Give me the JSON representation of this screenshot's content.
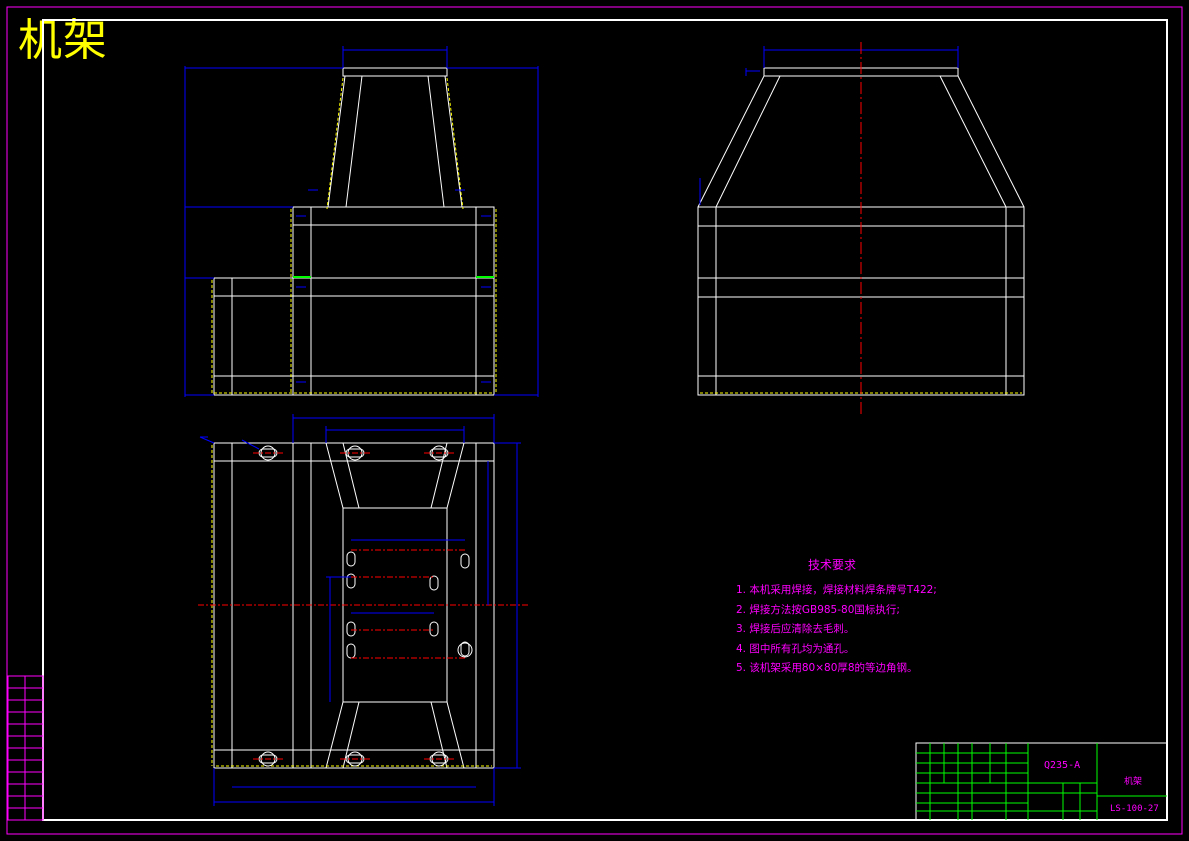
{
  "drawing": {
    "title": "机架",
    "line_colors": {
      "outline": "#ffffff",
      "dimension": "#0000ff",
      "center": "#ff0000",
      "frame": "#ff00ff",
      "weld": "#ffff00",
      "table": "#00ff00"
    }
  },
  "technical_requirements": {
    "heading": "技术要求",
    "items": [
      "1. 本机采用焊接，焊接材料焊条牌号T422;",
      "2. 焊接方法按GB985-80国标执行;",
      "3. 焊接后应清除去毛刺。",
      "4. 图中所有孔均为通孔。",
      "5. 该机架采用80×80厚8的等边角钢。"
    ]
  },
  "title_block": {
    "material": "Q235-A",
    "part_name": "机架",
    "drawing_number": "LS-100-27"
  }
}
